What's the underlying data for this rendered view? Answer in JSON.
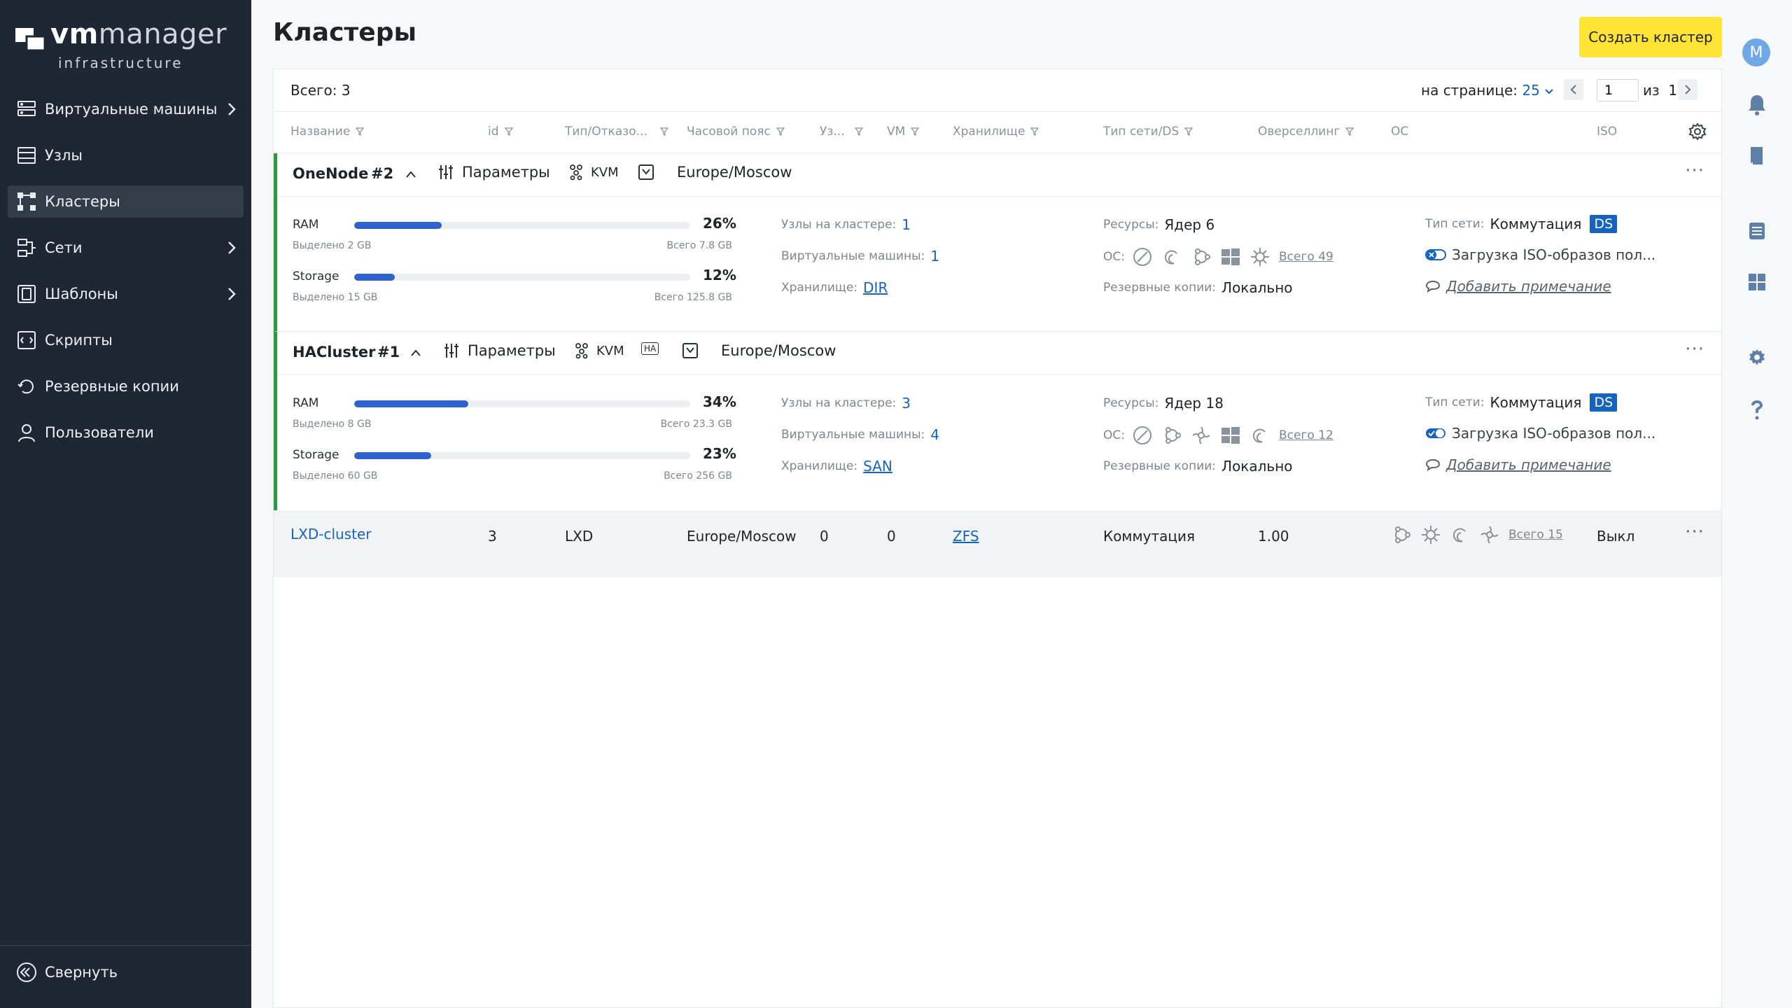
{
  "app": {
    "logo_vm": "vm",
    "logo_manager": "manager",
    "logo_sub": "infrastructure"
  },
  "sidebar": {
    "items": [
      {
        "label": "Виртуальные машины",
        "icon": "vm-icon",
        "has_chevron": true
      },
      {
        "label": "Узлы",
        "icon": "nodes-icon",
        "has_chevron": false
      },
      {
        "label": "Кластеры",
        "icon": "clusters-icon",
        "has_chevron": false,
        "active": true
      },
      {
        "label": "Сети",
        "icon": "networks-icon",
        "has_chevron": true
      },
      {
        "label": "Шаблоны",
        "icon": "templates-icon",
        "has_chevron": true
      },
      {
        "label": "Скрипты",
        "icon": "scripts-icon",
        "has_chevron": false
      },
      {
        "label": "Резервные копии",
        "icon": "backups-icon",
        "has_chevron": false
      },
      {
        "label": "Пользователи",
        "icon": "users-icon",
        "has_chevron": false
      }
    ],
    "collapse_label": "Свернуть"
  },
  "header": {
    "title": "Кластеры",
    "create_label": "Создать кластер",
    "avatar_letter": "M"
  },
  "toolbar": {
    "total": "Всего: 3",
    "per_page_label": "на странице:",
    "per_page_value": "25",
    "page": "1",
    "of_label": "из",
    "pages": "1"
  },
  "columns": [
    "Название",
    "id",
    "Тип/Отказо...",
    "Часовой пояс",
    "Уз...",
    "VM",
    "Хранилище",
    "Тип сети/DS",
    "Оверселлинг",
    "ОС",
    "ISO"
  ],
  "clusters": [
    {
      "name": "OneNode",
      "id": "#2",
      "params_label": "Параметры",
      "type": "KVM",
      "timezone": "Europe/Moscow",
      "ram_label": "RAM",
      "ram_pct": 26,
      "ram_pct_text": "26%",
      "ram_alloc": "Выделено 2 GB",
      "ram_total": "Всего 7.8 GB",
      "storage_label": "Storage",
      "storage_pct": 12,
      "storage_pct_text": "12%",
      "storage_alloc": "Выделено 15 GB",
      "storage_total": "Всего 125.8 GB",
      "nodes_label": "Узлы на кластере:",
      "nodes": "1",
      "vms_label": "Виртуальные машины:",
      "vms": "1",
      "storage_kind_label": "Хранилище:",
      "storage_kind": "DIR",
      "resources_label": "Ресурсы:",
      "resources": "Ядер 6",
      "os_label": "ОС:",
      "os_total": "Всего 49",
      "backups_label": "Резервные копии:",
      "backups": "Локально",
      "net_label": "Тип сети:",
      "net": "Коммутация",
      "ds": "DS",
      "iso_label": "Загрузка ISO-образов пол...",
      "iso_on": false,
      "note": "Добавить примечание"
    },
    {
      "name": "HACluster",
      "id": "#1",
      "params_label": "Параметры",
      "type": "KVM",
      "ha": "HA",
      "timezone": "Europe/Moscow",
      "ram_label": "RAM",
      "ram_pct": 34,
      "ram_pct_text": "34%",
      "ram_alloc": "Выделено 8 GB",
      "ram_total": "Всего 23.3 GB",
      "storage_label": "Storage",
      "storage_pct": 23,
      "storage_pct_text": "23%",
      "storage_alloc": "Выделено 60 GB",
      "storage_total": "Всего 256 GB",
      "nodes_label": "Узлы на кластере:",
      "nodes": "3",
      "vms_label": "Виртуальные машины:",
      "vms": "4",
      "storage_kind_label": "Хранилище:",
      "storage_kind": "SAN",
      "resources_label": "Ресурсы:",
      "resources": "Ядер 18",
      "os_label": "ОС:",
      "os_total": "Всего 12",
      "backups_label": "Резервные копии:",
      "backups": "Локально",
      "net_label": "Тип сети:",
      "net": "Коммутация",
      "ds": "DS",
      "iso_label": "Загрузка ISO-образов пол...",
      "iso_on": true,
      "note": "Добавить примечание"
    }
  ],
  "lxd": {
    "name": "LXD-cluster",
    "id": "3",
    "type": "LXD",
    "timezone": "Europe/Moscow",
    "nodes": "0",
    "vms": "0",
    "storage": "ZFS",
    "net": "Коммутация",
    "overselling": "1.00",
    "os_total": "Всего 15",
    "iso": "Выкл"
  },
  "colors": {
    "sidebar_bg": "#1e2733",
    "accent_yellow": "#ffe335",
    "link_blue": "#1565c0",
    "bar_blue": "#2d62cf",
    "cluster_border_green": "#2e9a3e"
  }
}
